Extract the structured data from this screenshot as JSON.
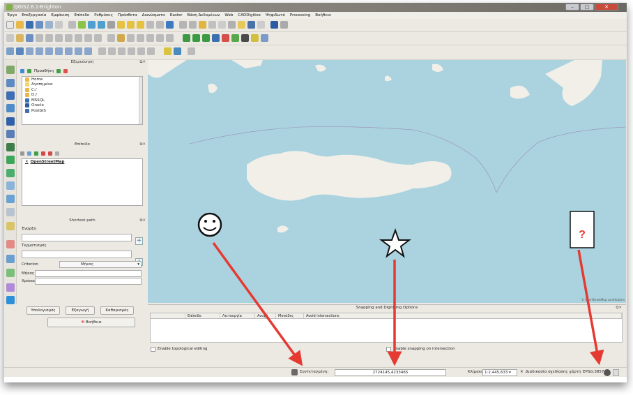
{
  "window": {
    "title": "QGIS2.6.1-Brighton",
    "controls": {
      "minimize": "–",
      "maximize": "□",
      "close": "✕"
    }
  },
  "menu": [
    "Έργο",
    "Επεξεργασία",
    "Εμφάνιση",
    "Επίπεδο",
    "Ρυθμίσεις",
    "Πρόσθετα",
    "Διανύσματα",
    "Raster",
    "Βάση Δεδομένων",
    "Web",
    "CADDigitize",
    "Ψηφιδωτό",
    "Processing",
    "Βοήθεια"
  ],
  "browser_panel": {
    "title": "Εξερεύνηση",
    "add_label": "Προσθήκη",
    "items": [
      "Home",
      "Αγαπημένα",
      "C:/",
      "D:/",
      "MSSQL",
      "Oracle",
      "PostGIS"
    ]
  },
  "layers_panel": {
    "title": "Επίπεδα",
    "layers": [
      {
        "name": "OpenStreetMap"
      }
    ]
  },
  "shortest_path": {
    "title": "Shortest path",
    "start_label": "Έναρξη",
    "end_label": "Τερματισμός",
    "criterion_label": "Criterion",
    "criterion_value": "Μήκος",
    "length_label": "Μήκος",
    "time_label": "Χρόνος",
    "calculate_button": "Υπολογισμός",
    "export_button": "Εξαγωγή",
    "clear_button": "Καθαρισμός",
    "help_button": "Βοήθεια"
  },
  "snapping": {
    "title": "Snapping and Digitizing Options",
    "columns": [
      "Επίπεδο",
      "Λειτουργία",
      "Ανοχή",
      "Μονάδες",
      "Avoid intersections"
    ],
    "topological_label": "Enable topological editing",
    "intersection_label": "Enable snapping on intersection"
  },
  "status": {
    "coord_label": "Συντεταγμένη:",
    "coord_value": "2724145,4233465",
    "scale_label": "Κλίμακα",
    "scale_value": "1:2,445,633",
    "render_label": "Διαδικασία σχεδίασης χάρτη",
    "crs": "EPSG:3857"
  },
  "map": {
    "attribution": "© OpenStreetMap contributors",
    "sea_color": "#aad3df",
    "land_color": "#f2efe9"
  },
  "annotations": {
    "question_mark": "?",
    "arrow_color": "#e53a32"
  }
}
